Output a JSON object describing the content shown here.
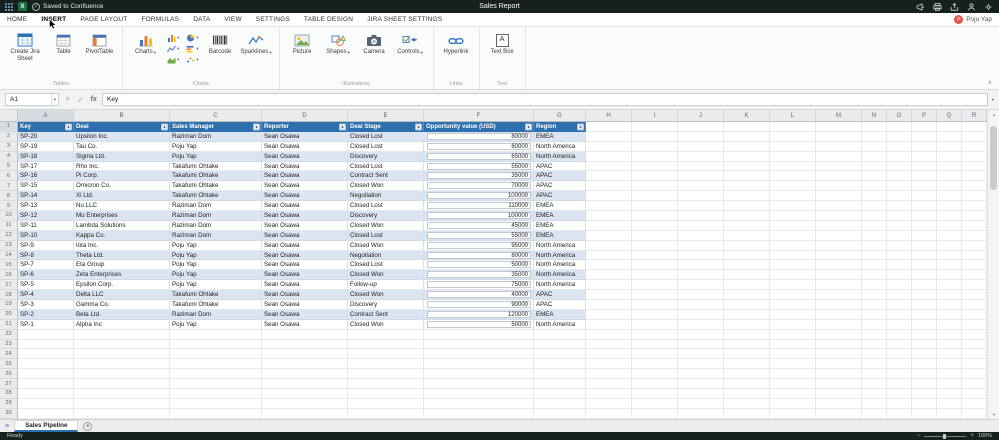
{
  "titlebar": {
    "saved": "Saved to Confluence",
    "title": "Sales Report"
  },
  "menu": {
    "tabs": [
      "HOME",
      "INSERT",
      "PAGE LAYOUT",
      "FORMULAS",
      "DATA",
      "VIEW",
      "SETTINGS",
      "TABLE DESIGN",
      "JIRA SHEET SETTINGS"
    ],
    "active": "INSERT",
    "user": "Poju Yap",
    "user_initial": "P"
  },
  "ribbon": {
    "create_jira": "Create Jira Sheet",
    "table": "Table",
    "pivot": "PivotTable",
    "charts": "Charts",
    "barcode": "Barcode",
    "sparklines": "Sparklines",
    "picture": "Picture",
    "shapes": "Shapes",
    "camera": "Camera",
    "controls": "Controls",
    "hyperlink": "Hyperlink",
    "textbox": "Text Box",
    "group_tables": "Tables",
    "group_charts": "Charts",
    "group_illustrations": "Illustrations",
    "group_links": "Links",
    "group_text": "Text",
    "mini_chart_buttons": [
      "column-chart",
      "pie-chart",
      "line-chart",
      "bar-chart",
      "area-chart",
      "scatter-chart"
    ]
  },
  "formula_bar": {
    "name_box": "A1",
    "value": "Key",
    "fx_label": "fx"
  },
  "sheet": {
    "columns": [
      "A",
      "B",
      "C",
      "D",
      "E",
      "F",
      "G",
      "H",
      "I",
      "J",
      "K",
      "L",
      "M",
      "N",
      "O",
      "P",
      "Q",
      "R"
    ],
    "header_row": [
      "Key",
      "Deal",
      "Sales Manager",
      "Reporter",
      "Deal Stage",
      "Opportunity value (USD)",
      "Region"
    ],
    "rows": [
      [
        "SP-20",
        "Upsilon Inc.",
        "Raziman Dom",
        "Sean Osawa",
        "Closed Lost",
        "80000",
        "EMEA"
      ],
      [
        "SP-19",
        "Tau Co.",
        "Poju Yap",
        "Sean Osawa",
        "Closed Lost",
        "60000",
        "North America"
      ],
      [
        "SP-18",
        "Sigma Ltd.",
        "Poju Yap",
        "Sean Osawa",
        "Discovery",
        "65000",
        "North America"
      ],
      [
        "SP-17",
        "Rho Inc.",
        "Takafumi Ohtake",
        "Sean Osawa",
        "Closed Lost",
        "55000",
        "APAC"
      ],
      [
        "SP-16",
        "Pi Corp.",
        "Takafumi Ohtake",
        "Sean Osawa",
        "Contract Sent",
        "35000",
        "APAC"
      ],
      [
        "SP-15",
        "Omicron Co.",
        "Takafumi Ohtake",
        "Sean Osawa",
        "Closed Won",
        "70000",
        "APAC"
      ],
      [
        "SP-14",
        "Xi Ltd.",
        "Takafumi Ohtake",
        "Sean Osawa",
        "Negotiation",
        "100000",
        "APAC"
      ],
      [
        "SP-13",
        "Nu LLC",
        "Raziman Dom",
        "Sean Osawa",
        "Closed Lost",
        "110000",
        "EMEA"
      ],
      [
        "SP-12",
        "Mu Enterprises",
        "Raziman Dom",
        "Sean Osawa",
        "Discovery",
        "100000",
        "EMEA"
      ],
      [
        "SP-11",
        "Lambda Solutions",
        "Raziman Dom",
        "Sean Osawa",
        "Closed Won",
        "45000",
        "EMEA"
      ],
      [
        "SP-10",
        "Kappa Co.",
        "Raziman Dom",
        "Sean Osawa",
        "Closed Lost",
        "55000",
        "EMEA"
      ],
      [
        "SP-9",
        "Iota Inc.",
        "Poju Yap",
        "Sean Osawa",
        "Closed Won",
        "95000",
        "North America"
      ],
      [
        "SP-8",
        "Theta Ltd.",
        "Poju Yap",
        "Sean Osawa",
        "Negotiation",
        "80000",
        "North America"
      ],
      [
        "SP-7",
        "Eta Group",
        "Poju Yap",
        "Sean Osawa",
        "Closed Lost",
        "50000",
        "North America"
      ],
      [
        "SP-6",
        "Zeta Enterprises",
        "Poju Yap",
        "Sean Osawa",
        "Closed Won",
        "35000",
        "North America"
      ],
      [
        "SP-5",
        "Epsilon Corp.",
        "Poju Yap",
        "Sean Osawa",
        "Follow-up",
        "75000",
        "North America"
      ],
      [
        "SP-4",
        "Delta LLC",
        "Takafumi Ohtake",
        "Sean Osawa",
        "Closed Won",
        "40000",
        "APAC"
      ],
      [
        "SP-3",
        "Gamma Co.",
        "Takafumi Ohtake",
        "Sean Osawa",
        "Discovery",
        "90000",
        "APAC"
      ],
      [
        "SP-2",
        "Beta Ltd.",
        "Raziman Dom",
        "Sean Osawa",
        "Contract Sent",
        "120000",
        "EMEA"
      ],
      [
        "SP-1",
        "Alpha Inc",
        "Poju Yap",
        "Sean Osawa",
        "Closed Won",
        "50000",
        "North America"
      ]
    ],
    "row_count": 30
  },
  "tabs_bar": {
    "sheet_tab": "Sales Pipeline",
    "add": "+"
  },
  "status": {
    "ready": "Ready",
    "zoom": "100%"
  },
  "colors": {
    "table_header": "#2e6fad",
    "band_row": "#dbe5f2",
    "titlebar": "#16201e"
  }
}
